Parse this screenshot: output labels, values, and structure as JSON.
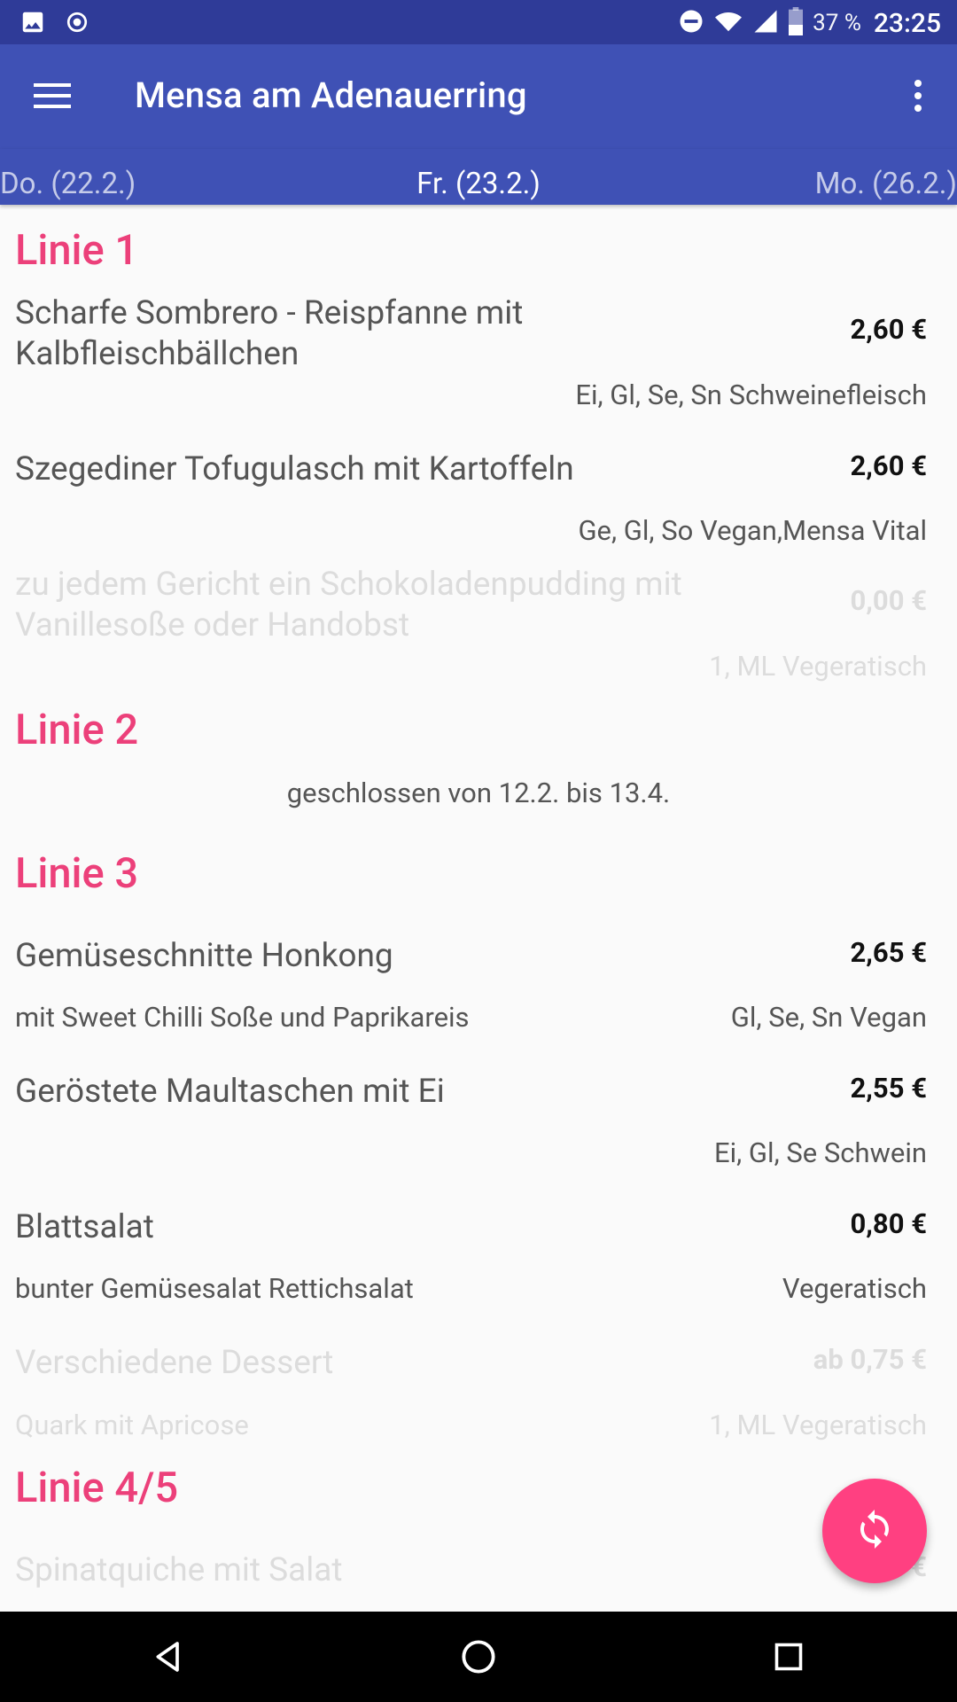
{
  "status_bar": {
    "battery": "37 %",
    "time": "23:25",
    "icons": [
      "image-icon",
      "record-icon",
      "do-not-disturb-icon",
      "wifi-icon",
      "signal-icon",
      "battery-icon"
    ]
  },
  "app_bar": {
    "title": "Mensa am Adenauerring",
    "menu_icon": "hamburger-menu-icon",
    "more_icon": "more-vert-icon"
  },
  "days": {
    "previous": "Do. (22.2.)",
    "current": "Fr. (23.2.)",
    "next": "Mo. (26.2.)"
  },
  "lines": [
    {
      "title": "Linie 1",
      "meals": [
        {
          "name": "Scharfe Sombrero - Reispfanne mit Kalbfleischbällchen",
          "price": "2,60 €",
          "sub_left": "",
          "sub_right": "Ei, Gl, Se, Sn Schweinefleisch"
        },
        {
          "name": "Szegediner Tofugulasch mit Kartoffeln",
          "price": "2,60 €",
          "sub_left": "",
          "sub_right": "Ge, Gl, So Vegan,Mensa Vital"
        },
        {
          "name": "zu jedem Gericht ein Schokoladenpudding mit Vanillesoße oder Handobst",
          "price": "0,00 €",
          "sub_left": "",
          "sub_right": "1, ML Vegeratisch"
        }
      ]
    },
    {
      "title": "Linie 2",
      "note": "geschlossen von 12.2. bis 13.4."
    },
    {
      "title": "Linie 3",
      "meals": [
        {
          "name": "Gemüseschnitte Honkong",
          "price": "2,65 €",
          "sub_left": "mit Sweet Chilli Soße und Paprikareis",
          "sub_right": "Gl, Se, Sn Vegan"
        },
        {
          "name": "Geröstete Maultaschen mit Ei",
          "price": "2,55 €",
          "sub_left": "",
          "sub_right": "Ei, Gl, Se Schwein"
        },
        {
          "name": "Blattsalat",
          "price": "0,80 €",
          "sub_left": "bunter Gemüsesalat Rettichsalat",
          "sub_right": "Vegeratisch"
        },
        {
          "name": "Verschiedene Dessert",
          "price": "ab 0,75 €",
          "sub_left": "Quark mit Apricose",
          "sub_right": "1, ML Vegeratisch"
        }
      ]
    },
    {
      "title": "Linie 4/5",
      "meals": [
        {
          "name": "Spinatquiche mit Salat",
          "price": "€"
        }
      ]
    }
  ],
  "fab": {
    "icon": "refresh-sync-icon"
  },
  "nav_bar": {
    "icons": [
      "back-icon",
      "home-icon",
      "recents-icon"
    ]
  }
}
